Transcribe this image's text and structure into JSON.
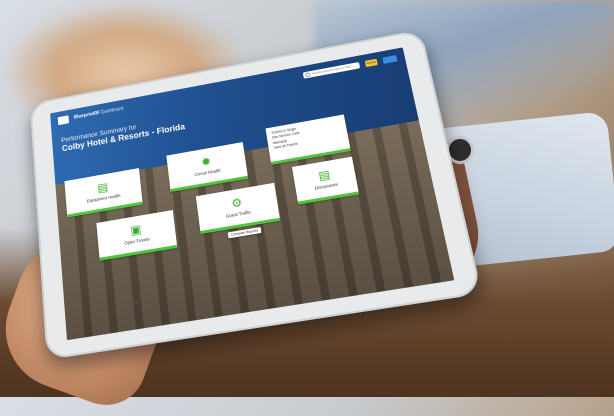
{
  "header": {
    "brand_bold": "BlueprintRF",
    "brand_thin": "Dashboard",
    "search_placeholder": "Search a device name or MAC",
    "go_label": "Search"
  },
  "summary": {
    "subtitle": "Performance Summary for",
    "title": "Colby Hotel & Resorts - Florida"
  },
  "tiles": {
    "equipment_health": "Equipment Health",
    "circuit_health": "Circuit Health",
    "guest_traffic": "Guest Traffic",
    "open_tickets": "Open Tickets",
    "documents": "Documents"
  },
  "quick_links": [
    "Tickets in Stage",
    "Site Service Calls",
    "Warranty",
    "View all Tickets"
  ],
  "chip_label": "Compare Reports",
  "icons": {
    "equipment": "router-icon",
    "circuit": "sun-icon",
    "traffic": "gear-icon",
    "tickets": "ticket-icon",
    "documents": "document-icon"
  },
  "colors": {
    "accent_green": "#4fc63b",
    "header_blue": "#1f4f8f"
  }
}
